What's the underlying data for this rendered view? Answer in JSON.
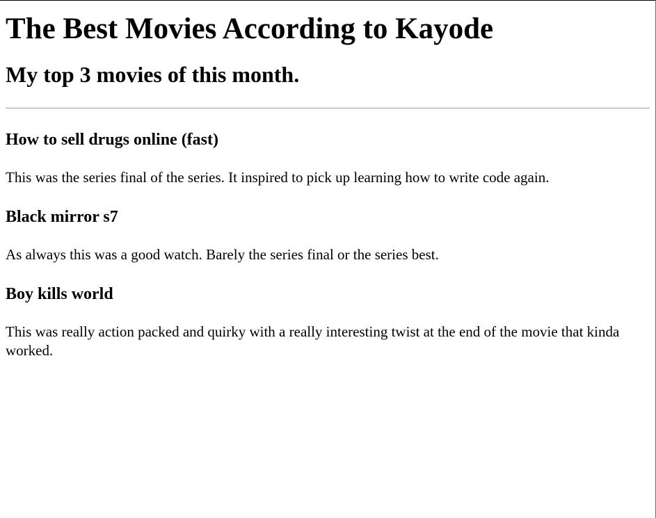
{
  "page": {
    "title": "The Best Movies According to Kayode",
    "subtitle": "My top 3 movies of this month."
  },
  "movies": [
    {
      "title": "How to sell drugs online (fast)",
      "review": "This was the series final of the series. It inspired to pick up learning how to write code again."
    },
    {
      "title": "Black mirror s7",
      "review": "As always this was a good watch. Barely the series final or the series best."
    },
    {
      "title": "Boy kills world",
      "review": "This was really action packed and quirky with a really interesting twist at the end of the movie that kinda worked."
    }
  ]
}
